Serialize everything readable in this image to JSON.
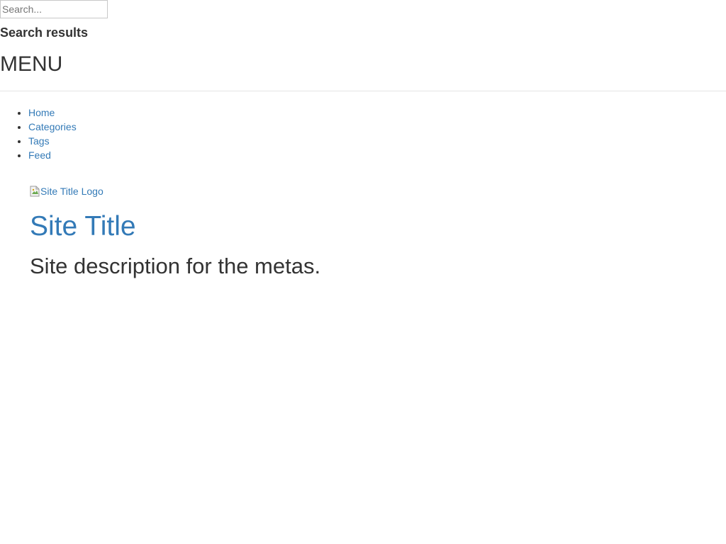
{
  "search": {
    "placeholder": "Search...",
    "results_label": "Search results"
  },
  "menu": {
    "heading": "MENU",
    "items": [
      {
        "label": "Home"
      },
      {
        "label": "Categories"
      },
      {
        "label": "Tags"
      },
      {
        "label": "Feed"
      }
    ]
  },
  "header": {
    "logo_alt": "Site Title Logo",
    "site_title": "Site Title",
    "site_description": "Site description for the metas."
  },
  "colors": {
    "link": "#337ab7",
    "text": "#333333",
    "divider": "#e5e5e5"
  },
  "icons": {
    "logo_placeholder": "broken-image-icon"
  }
}
